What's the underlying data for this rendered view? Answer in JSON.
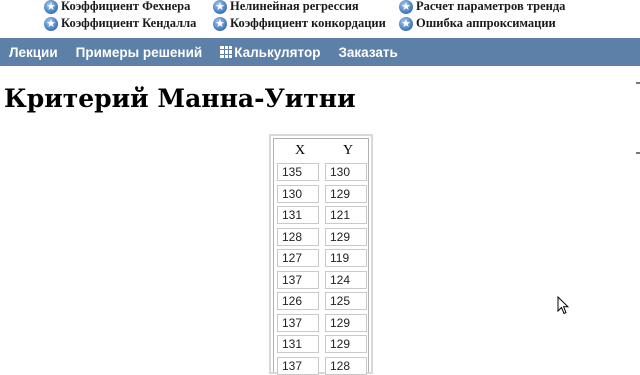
{
  "top_links": {
    "row1": [
      "Коэффициент Фехнера",
      "Нелинейная регрессия",
      "Расчет параметров тренда"
    ],
    "row2": [
      "Коэффициент Кендалла",
      "Коэффициент конкордации",
      "Ошибка аппроксимации"
    ]
  },
  "nav": {
    "items": [
      "Лекции",
      "Примеры решений",
      "Калькулятор",
      "Заказать"
    ],
    "calculator_icon": "grid-icon"
  },
  "page": {
    "title": "Критерий Манна-Уитни"
  },
  "table": {
    "headers": [
      "X",
      "Y"
    ],
    "rows": [
      [
        "135",
        "130"
      ],
      [
        "130",
        "129"
      ],
      [
        "131",
        "121"
      ],
      [
        "128",
        "129"
      ],
      [
        "127",
        "119"
      ],
      [
        "137",
        "124"
      ],
      [
        "126",
        "125"
      ],
      [
        "137",
        "129"
      ],
      [
        "131",
        "129"
      ],
      [
        "137",
        "128"
      ]
    ]
  },
  "colors": {
    "nav_bg": "#5d80a8",
    "nav_text": "#ffffff",
    "link_icon": "#4a7fc0"
  }
}
